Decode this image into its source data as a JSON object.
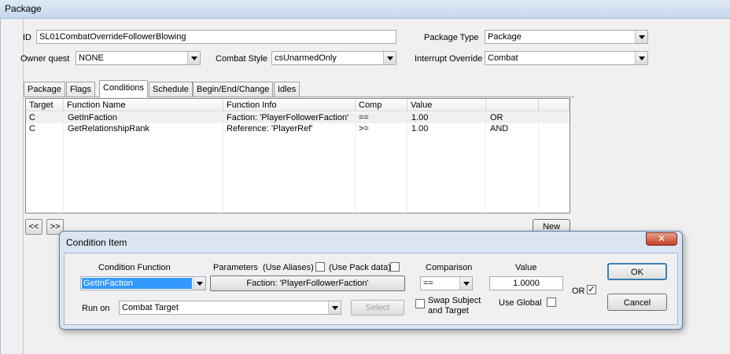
{
  "window": {
    "title": "Package"
  },
  "form": {
    "id_label": "ID",
    "id_value": "SL01CombatOverrideFollowerBlowing",
    "package_type_label": "Package Type",
    "package_type_value": "Package",
    "owner_quest_label": "Owner quest",
    "owner_quest_value": "NONE",
    "combat_style_label": "Combat Style",
    "combat_style_value": "csUnarmedOnly",
    "interrupt_override_label": "Interrupt Override",
    "interrupt_override_value": "Combat"
  },
  "tabs": [
    {
      "label": "Package"
    },
    {
      "label": "Flags"
    },
    {
      "label": "Conditions"
    },
    {
      "label": "Schedule"
    },
    {
      "label": "Begin/End/Change"
    },
    {
      "label": "Idles"
    }
  ],
  "grid": {
    "headers": [
      "Target",
      "Function Name",
      "Function Info",
      "Comp",
      "Value",
      ""
    ],
    "rows": [
      {
        "target": "C",
        "function": "GetInFaction",
        "info": "Faction: 'PlayerFollowerFaction'",
        "comp": "==",
        "value": "1.00",
        "op": "OR"
      },
      {
        "target": "C",
        "function": "GetRelationshipRank",
        "info": "Reference: 'PlayerRef'",
        "comp": ">=",
        "value": "1.00",
        "op": "AND"
      }
    ]
  },
  "nav": {
    "prev": "<<",
    "next": ">>",
    "new_label": "New"
  },
  "dialog": {
    "title": "Condition Item",
    "close": "✕",
    "condition_function_label": "Condition Function",
    "condition_function_value": "GetInFaction",
    "parameters_label": "Parameters",
    "use_aliases_label": "(Use Aliases)",
    "use_pack_data_label": "(Use Pack data)",
    "parameter_button": "Faction: 'PlayerFollowerFaction'",
    "comparison_label": "Comparison",
    "comparison_value": "==",
    "value_label": "Value",
    "value_value": "1.0000",
    "or_label": "OR",
    "or_checked": "✓",
    "run_on_label": "Run on",
    "run_on_value": "Combat Target",
    "select_button": "Select",
    "swap_label_1": "Swap Subject",
    "swap_label_2": "and Target",
    "use_global_label": "Use Global",
    "ok_label": "OK",
    "cancel_label": "Cancel"
  }
}
